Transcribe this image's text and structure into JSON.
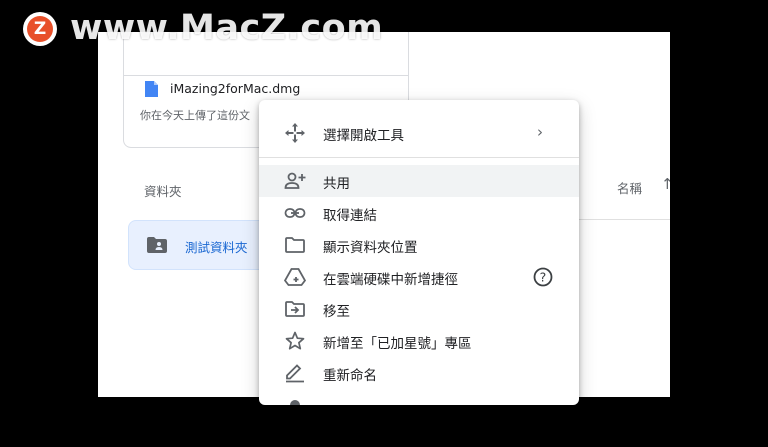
{
  "file_card": {
    "file_name": "iMazing2forMac.dmg",
    "upload_note": "你在今天上傳了這份文"
  },
  "list": {
    "section_label": "資料夾",
    "sort_label": "名稱",
    "sort_arrow": "↑"
  },
  "folder": {
    "name": "測試資料夾"
  },
  "context_menu": {
    "items": [
      {
        "label": "選擇開啟工具",
        "icon": "move-arrows-icon",
        "submenu": "›"
      },
      {
        "label": "共用",
        "icon": "person-add-icon"
      },
      {
        "label": "取得連結",
        "icon": "link-icon"
      },
      {
        "label": "顯示資料夾位置",
        "icon": "folder-outline-icon"
      },
      {
        "label": "在雲端硬碟中新增捷徑",
        "icon": "drive-shortcut-icon",
        "help": "?"
      },
      {
        "label": "移至",
        "icon": "move-to-folder-icon"
      },
      {
        "label": "新增至「已加星號」專區",
        "icon": "star-outline-icon"
      },
      {
        "label": "重新命名",
        "icon": "pencil-icon"
      }
    ]
  },
  "watermark": {
    "logo_letter": "Z",
    "text": "www.MacZ.com"
  },
  "colors": {
    "accent": "#1967d2",
    "folder_bg": "#e8f0fe",
    "highlight": "#f1f3f4",
    "watermark_logo": "#e8502a"
  }
}
